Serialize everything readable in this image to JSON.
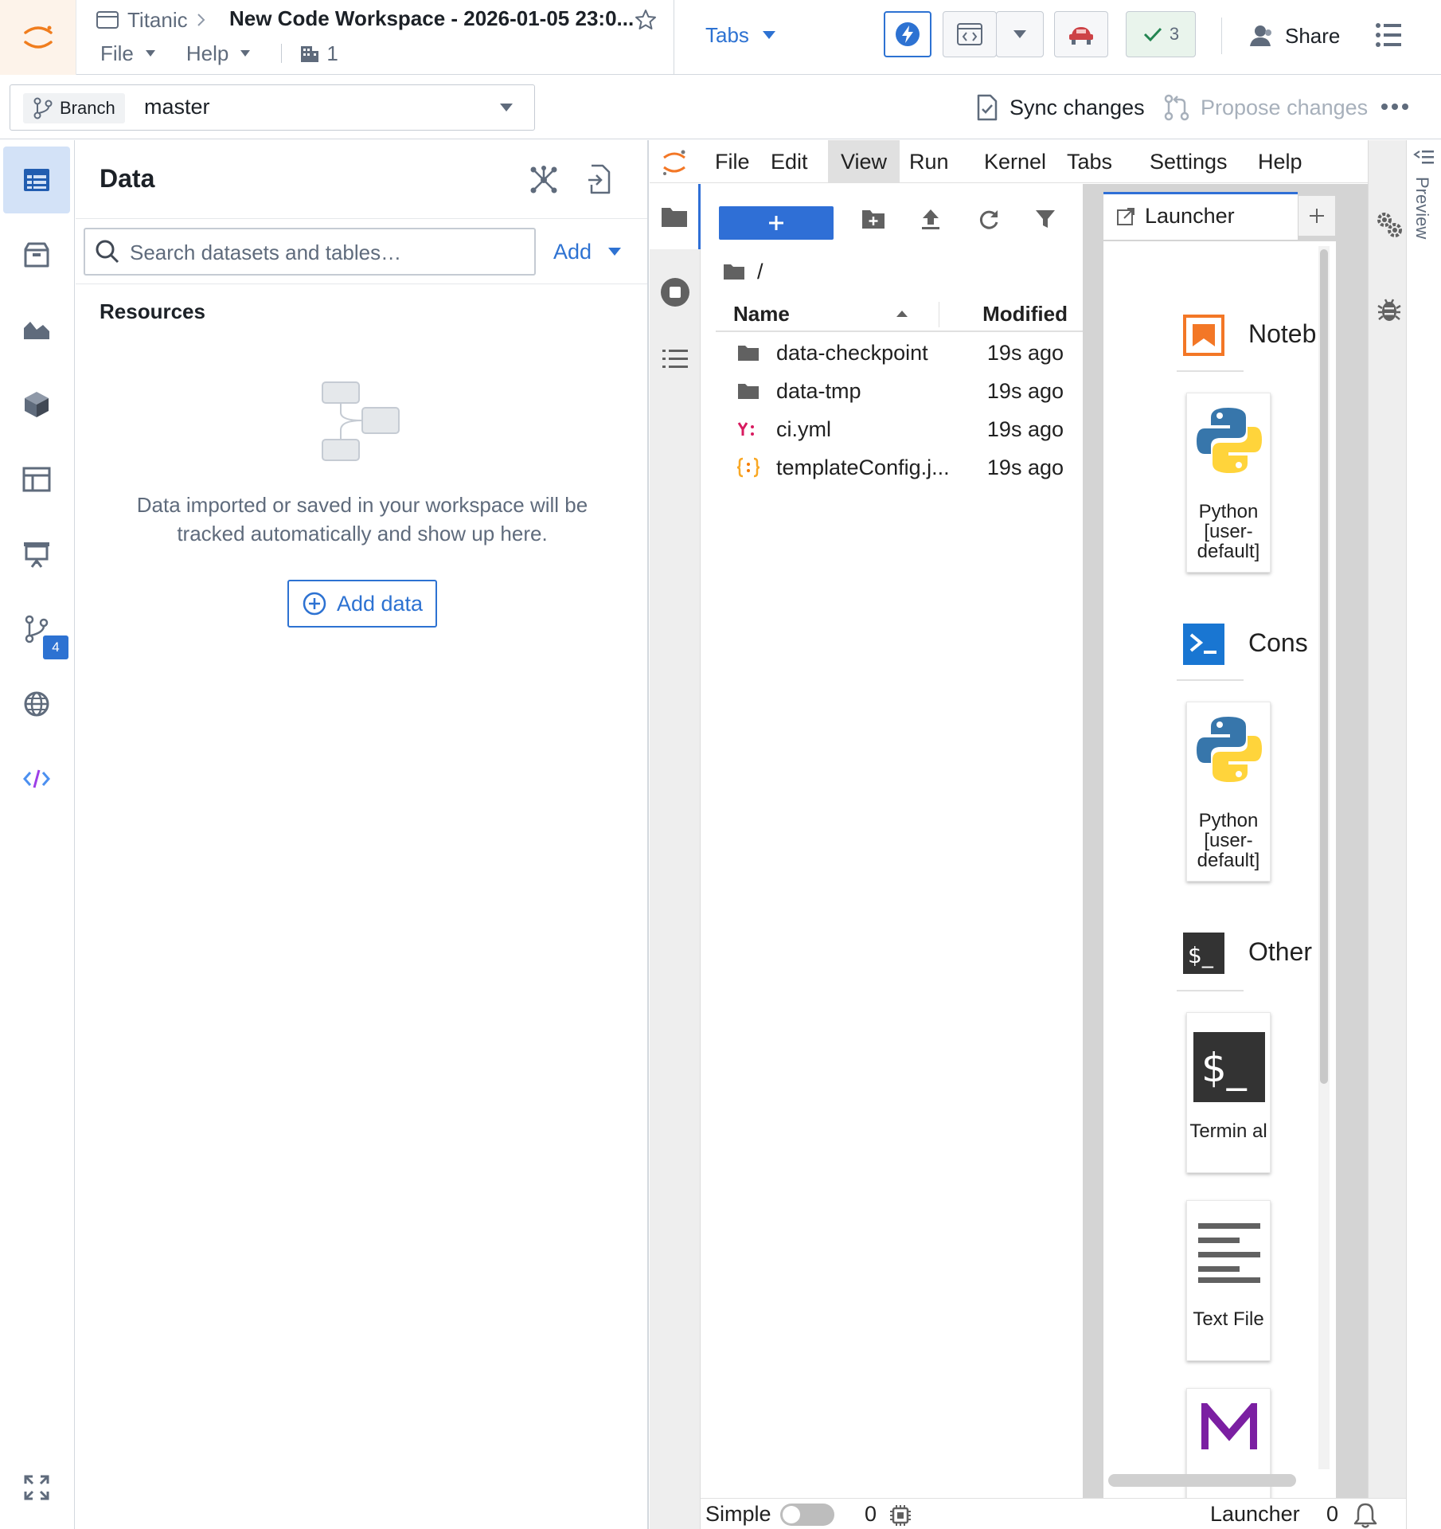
{
  "app": {
    "project": "Titanic",
    "workspace_title": "New Code Workspace - 2026-01-05 23:0...",
    "menus": [
      "File",
      "Help"
    ],
    "member_count": "1",
    "tabs_label": "Tabs",
    "checks_count": "3",
    "share_label": "Share",
    "accent": "#2d72d2"
  },
  "branch": {
    "tag_label": "Branch",
    "name": "master",
    "sync_label": "Sync changes",
    "propose_label": "Propose changes"
  },
  "rail": {
    "badge_count": "4"
  },
  "data_panel": {
    "title": "Data",
    "search_placeholder": "Search datasets and tables…",
    "add_label": "Add",
    "resources_label": "Resources",
    "empty_message": "Data imported or saved in your workspace will be tracked automatically and show up here.",
    "add_data_label": "Add data"
  },
  "jupyter": {
    "menu": [
      "File",
      "Edit",
      "View",
      "Run",
      "Kernel",
      "Tabs",
      "Settings",
      "Help"
    ],
    "active_menu": "View",
    "path": "/",
    "columns": {
      "name": "Name",
      "modified": "Modified"
    },
    "files": [
      {
        "name": "data-checkpoint",
        "modified": "19s ago",
        "icon": "folder-icon"
      },
      {
        "name": "data-tmp",
        "modified": "19s ago",
        "icon": "folder-icon"
      },
      {
        "name": "ci.yml",
        "modified": "19s ago",
        "icon": "yaml-file-icon"
      },
      {
        "name": "templateConfig.j...",
        "modified": "19s ago",
        "icon": "json-file-icon"
      }
    ],
    "launcher": {
      "tab_label": "Launcher",
      "sections": {
        "notebook": "Noteb",
        "console": "Cons",
        "other": "Other"
      },
      "cards": {
        "notebook_python": "Python [user-default]",
        "console_python": "Python [user-default]",
        "terminal": "Termin al",
        "text_file": "Text File"
      }
    },
    "preview_label": "Preview",
    "status": {
      "mode_label": "Simple",
      "kernels": "0",
      "current_tab": "Launcher",
      "notifications": "0"
    }
  }
}
